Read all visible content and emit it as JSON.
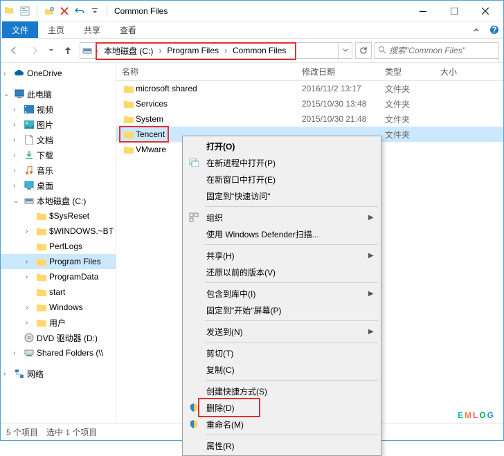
{
  "window": {
    "title": "Common Files"
  },
  "ribbon": {
    "file": "文件",
    "tabs": [
      "主页",
      "共享",
      "查看"
    ]
  },
  "breadcrumb": {
    "items": [
      "本地磁盘 (C:)",
      "Program Files",
      "Common Files"
    ]
  },
  "search": {
    "placeholder": "搜索\"Common Files\""
  },
  "columns": {
    "name": "名称",
    "date": "修改日期",
    "type": "类型",
    "size": "大小"
  },
  "navTree": {
    "onedrive": "OneDrive",
    "thispc": "此电脑",
    "videos": "视频",
    "pictures": "图片",
    "documents": "文档",
    "downloads": "下载",
    "music": "音乐",
    "desktop": "桌面",
    "cdrive": "本地磁盘 (C:)",
    "sysreset": "$SysReset",
    "windows_bt": "$WINDOWS.~BT",
    "perflogs": "PerfLogs",
    "programfiles": "Program Files",
    "programdata": "ProgramData",
    "start": "start",
    "windows": "Windows",
    "users": "用户",
    "dvd": "DVD 驱动器 (D:)",
    "sharedfolders": "Shared Folders (\\\\",
    "network": "网络"
  },
  "files": [
    {
      "name": "microsoft shared",
      "date": "2016/11/2 13:17",
      "type": "文件夹"
    },
    {
      "name": "Services",
      "date": "2015/10/30 13:48",
      "type": "文件夹"
    },
    {
      "name": "System",
      "date": "2015/10/30 21:48",
      "type": "文件夹"
    },
    {
      "name": "Tencent",
      "date": "",
      "type": "文件夹"
    },
    {
      "name": "VMware",
      "date": "",
      "type": ""
    }
  ],
  "contextMenu": {
    "open": "打开(O)",
    "openNewProcess": "在新进程中打开(P)",
    "openNewWindow": "在新窗口中打开(E)",
    "pinQuickAccess": "固定到\"快速访问\"",
    "organize": "组织",
    "defender": "使用 Windows Defender扫描...",
    "share": "共享(H)",
    "restorePrev": "还原以前的版本(V)",
    "includeLibrary": "包含到库中(I)",
    "pinStart": "固定到\"开始\"屏幕(P)",
    "sendTo": "发送到(N)",
    "cut": "剪切(T)",
    "copy": "复制(C)",
    "createShortcut": "创建快捷方式(S)",
    "delete": "删除(D)",
    "rename": "重命名(M)",
    "properties": "属性(R)"
  },
  "status": {
    "items": "5 个项目",
    "selected": "选中 1 个项目"
  },
  "watermark": {
    "e": "E",
    "m": "M",
    "l": "L",
    "o": "O",
    "g": "G"
  }
}
